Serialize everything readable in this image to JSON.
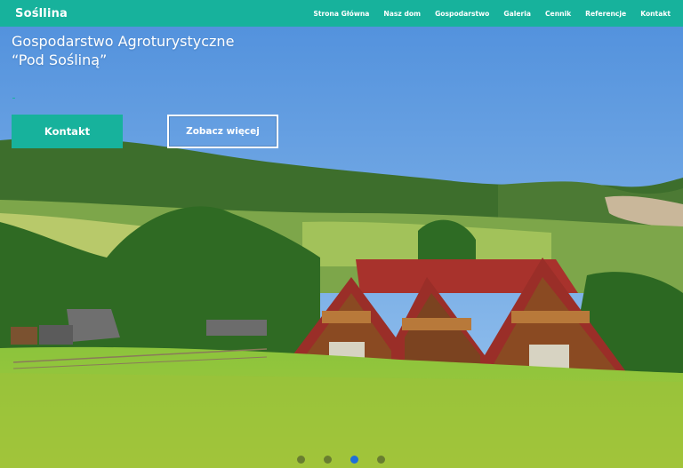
{
  "brand": {
    "name": "Sośllina"
  },
  "nav": {
    "items": [
      {
        "label": "Strona Główna"
      },
      {
        "label": "Nasz dom"
      },
      {
        "label": "Gospodarstwo"
      },
      {
        "label": "Galeria"
      },
      {
        "label": "Cennik"
      },
      {
        "label": "Referencje"
      },
      {
        "label": "Kontakt"
      }
    ]
  },
  "hero": {
    "title_line1": "Gospodarstwo Agroturystyczne",
    "title_line2": "“Pod Sośliną”",
    "primary_button": "Kontakt",
    "secondary_button": "Zobacz więcej"
  },
  "carousel": {
    "slide_count": 4,
    "active_index": 2
  },
  "colors": {
    "accent": "#17b29c",
    "active_dot": "#1e6fd9",
    "sky": "#5f9be0"
  }
}
